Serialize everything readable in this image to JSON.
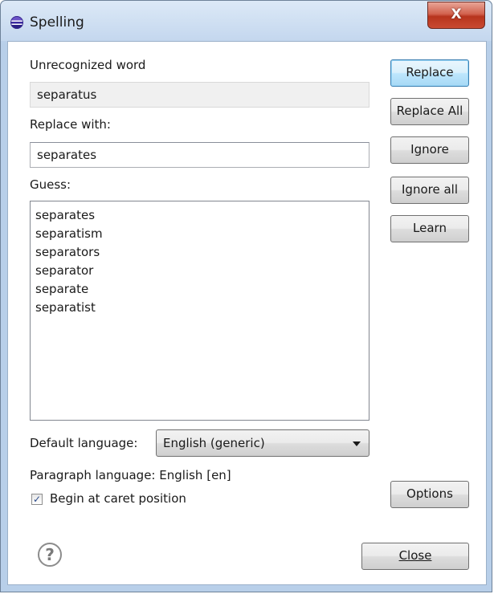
{
  "window": {
    "title": "Spelling",
    "close_glyph": "X",
    "icon": "eclipse-app-icon"
  },
  "unrecognized": {
    "label": "Unrecognized word",
    "value": "separatus"
  },
  "replace_with": {
    "label": "Replace with:",
    "value": "separates"
  },
  "guess": {
    "label": "Guess:",
    "items": [
      "separates",
      "separatism",
      "separators",
      "separator",
      "separate",
      "separatist"
    ]
  },
  "buttons": {
    "replace": "Replace",
    "replace_all": "Replace All",
    "ignore": "Ignore",
    "ignore_all": "Ignore all",
    "learn": "Learn",
    "options": "Options",
    "close": "Close"
  },
  "default_language": {
    "label": "Default language:",
    "selected": "English (generic)"
  },
  "paragraph_language": {
    "label": "Paragraph language:",
    "value": "English [en]"
  },
  "begin_at_caret": {
    "label": "Begin at caret position",
    "checked": true
  },
  "help": {
    "glyph": "?"
  },
  "colors": {
    "default_button_border": "#3c7fb1",
    "title_bar": "#c4d7ee",
    "close_button": "#c94a32"
  }
}
